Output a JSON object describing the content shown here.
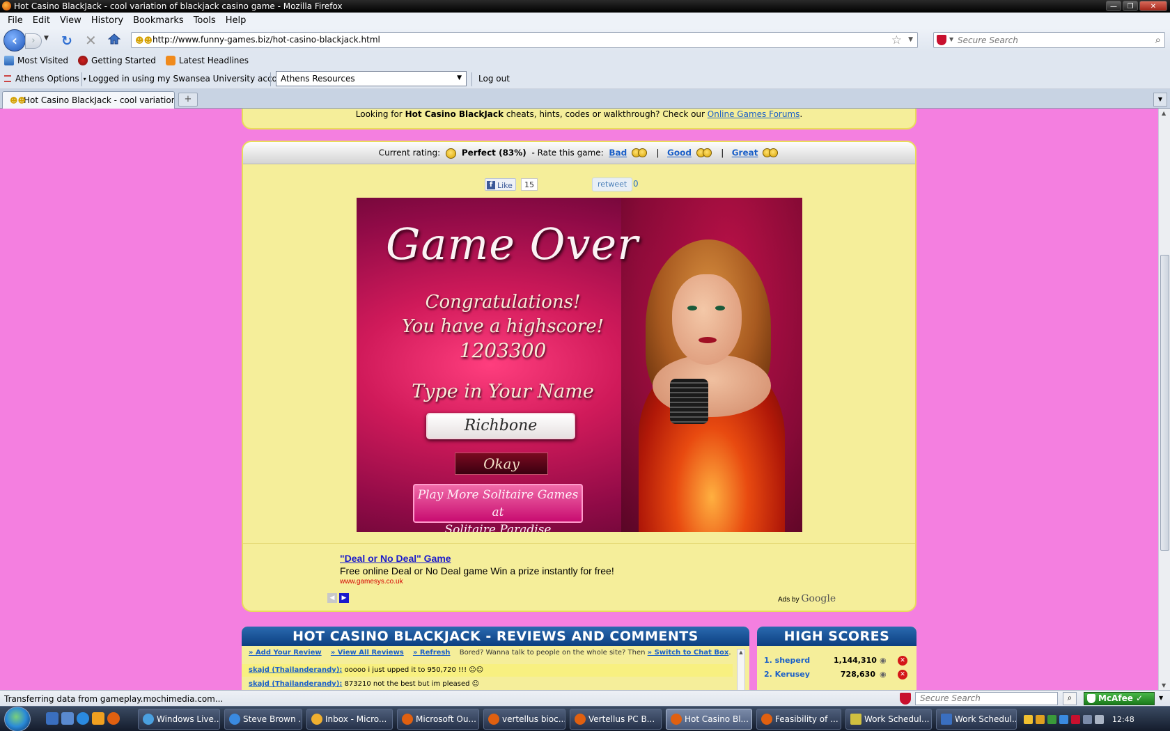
{
  "window": {
    "title": "Hot Casino BlackJack - cool variation of blackjack casino game - Mozilla Firefox"
  },
  "menu": [
    "File",
    "Edit",
    "View",
    "History",
    "Bookmarks",
    "Tools",
    "Help"
  ],
  "nav": {
    "url": "http://www.funny-games.biz/hot-casino-blackjack.html",
    "search_placeholder": "Secure Search"
  },
  "bookmarks": [
    "Most Visited",
    "Getting Started",
    "Latest Headlines"
  ],
  "athens": {
    "options_label": "Athens Options",
    "logged_in": "Logged in using my Swansea University account",
    "resources_selected": "Athens Resources",
    "logout_label": "Log out"
  },
  "tabs": [
    {
      "label": "Hot Casino BlackJack - cool variation ...",
      "active": true
    }
  ],
  "page": {
    "top_notice": {
      "prefix": "Looking for ",
      "game_name": "Hot Casino BlackJack",
      "middle": " cheats, hints, codes or walkthrough? Check our ",
      "link": "Online Games Forums",
      "suffix": "."
    },
    "rating": {
      "current_label": "Current rating:",
      "current_value": "Perfect (83%)",
      "rate_label": "- Rate this game:",
      "bad": "Bad",
      "good": "Good",
      "great": "Great",
      "sep": "|"
    },
    "social": {
      "like_label": "Like",
      "like_count": "15",
      "retweet_label": "retweet",
      "retweet_count": "0"
    },
    "game": {
      "title": "Game Over",
      "line1": "Congratulations!",
      "line2": "You have a highscore!",
      "score": "1203300",
      "prompt": "Type in Your Name",
      "name_value": "Richbone",
      "okay_label": "Okay",
      "promo_line1": "Play More Solitaire Games at",
      "promo_line2": "Solitaire Paradise"
    },
    "ad": {
      "title": "\"Deal or No Deal\" Game",
      "description": "Free online Deal or No Deal game Win a prize instantly for free!",
      "url": "www.gamesys.co.uk",
      "ads_by": "Ads by",
      "google": "Google"
    },
    "reviews": {
      "heading": "HOT CASINO BLACKJACK - REVIEWS AND COMMENTS",
      "add_review": "» Add Your Review",
      "view_all": "» View All Reviews",
      "refresh": "» Refresh",
      "chat_prompt": "Bored? Wanna talk to people on the whole site? Then",
      "chat_link": "» Switch to Chat Box",
      "chat_suffix": ".",
      "entries": [
        {
          "author": "skajd (Thailanderandy):",
          "text": " ooooo i just upped it to 950,720 !!! ☺☺"
        },
        {
          "author": "skajd (Thailanderandy):",
          "text": " 873210 not the best but im pleased ☺"
        }
      ]
    },
    "highscores": {
      "heading": "HIGH SCORES",
      "entries": [
        {
          "rank_name": "1. sheperd",
          "score": "1,144,310"
        },
        {
          "rank_name": "2. Kerusey",
          "score": "728,630"
        }
      ]
    }
  },
  "status": {
    "text": "Transferring data from gameplay.mochimedia.com...",
    "search_placeholder": "Secure Search",
    "mcafee": "McAfee"
  },
  "taskbar": {
    "tasks": [
      "Windows Live...",
      "Steve Brown ...",
      "Inbox - Micro...",
      "Microsoft Ou...",
      "vertellus bioc...",
      "Vertellus PC B...",
      "Hot Casino Bl...",
      "Feasibility of ...",
      "Work Schedul...",
      "Work Schedul..."
    ],
    "clock": "12:48"
  }
}
